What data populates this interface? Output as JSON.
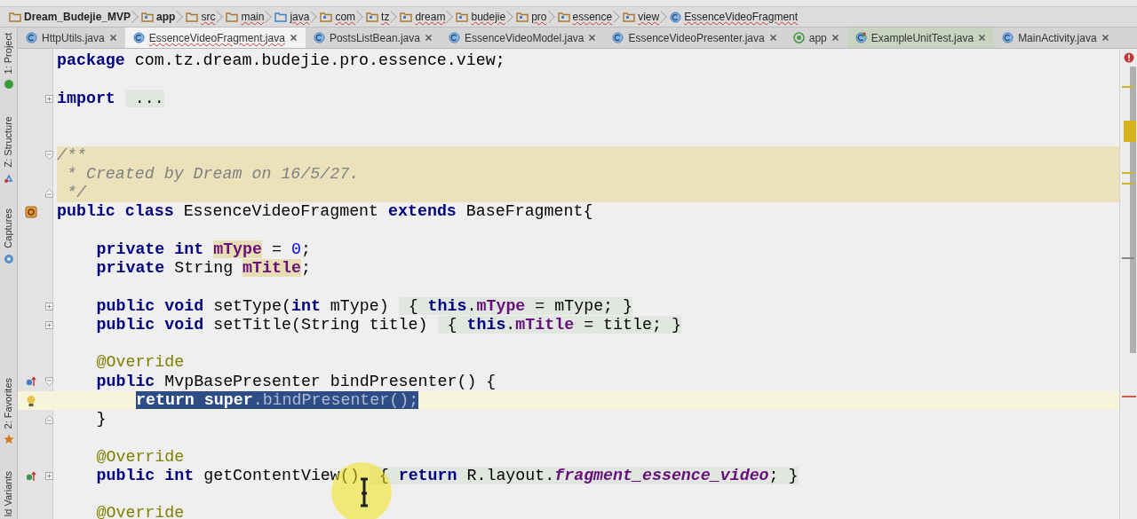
{
  "breadcrumbs": [
    {
      "label": "Dream_Budejie_MVP",
      "kind": "project",
      "spell_error": false
    },
    {
      "label": "app",
      "kind": "module",
      "spell_error": false
    },
    {
      "label": "src",
      "kind": "folder",
      "spell_error": true
    },
    {
      "label": "main",
      "kind": "folder",
      "spell_error": true
    },
    {
      "label": "java",
      "kind": "source",
      "spell_error": true
    },
    {
      "label": "com",
      "kind": "package",
      "spell_error": true
    },
    {
      "label": "tz",
      "kind": "package",
      "spell_error": true
    },
    {
      "label": "dream",
      "kind": "package",
      "spell_error": true
    },
    {
      "label": "budejie",
      "kind": "package",
      "spell_error": true
    },
    {
      "label": "pro",
      "kind": "package",
      "spell_error": true
    },
    {
      "label": "essence",
      "kind": "package",
      "spell_error": true
    },
    {
      "label": "view",
      "kind": "package",
      "spell_error": true
    },
    {
      "label": "EssenceVideoFragment",
      "kind": "class",
      "spell_error": true
    }
  ],
  "tool_windows": [
    {
      "label": "1: Project",
      "kind": "project"
    },
    {
      "label": "Z: Structure",
      "kind": "structure"
    },
    {
      "label": "Captures",
      "kind": "captures"
    },
    {
      "label": "2: Favorites",
      "kind": "favorites"
    },
    {
      "label": "ld Variants",
      "kind": "variants"
    }
  ],
  "tabs": [
    {
      "label": "HttpUtils.java",
      "kind": "class",
      "selected": false,
      "spell_error": false
    },
    {
      "label": "EssenceVideoFragment.java",
      "kind": "class",
      "selected": true,
      "spell_error": true
    },
    {
      "label": "PostsListBean.java",
      "kind": "class",
      "selected": false,
      "spell_error": false
    },
    {
      "label": "EssenceVideoModel.java",
      "kind": "class",
      "selected": false,
      "spell_error": false
    },
    {
      "label": "EssenceVideoPresenter.java",
      "kind": "class",
      "selected": false,
      "spell_error": false
    },
    {
      "label": "app",
      "kind": "module",
      "selected": false,
      "spell_error": false
    },
    {
      "label": "ExampleUnitTest.java",
      "kind": "test",
      "selected": false,
      "spell_error": false
    },
    {
      "label": "MainActivity.java",
      "kind": "class",
      "selected": false,
      "spell_error": false
    }
  ],
  "lines": [
    {
      "kind": "code",
      "tokens": [
        {
          "text": "package",
          "kind": "kw"
        },
        {
          "text": "com.tz.dream.budejie.pro.essence.view;",
          "kind": "plain",
          "gap": true
        }
      ]
    },
    {
      "kind": "blank"
    },
    {
      "kind": "code",
      "fold_marker": {
        "kind": "plus"
      },
      "tokens": [
        {
          "text": "import",
          "kind": "kw"
        }
      ],
      "folded": [
        {
          "text": "...",
          "kind": "plain",
          "gap": true
        }
      ]
    },
    {
      "kind": "blank"
    },
    {
      "kind": "blank"
    },
    {
      "kind": "code",
      "fold_marker": {
        "kind": "start"
      },
      "doc_comment": true,
      "tokens": [
        {
          "text": "/**",
          "kind": "comment"
        }
      ]
    },
    {
      "kind": "code",
      "doc_comment": true,
      "tokens": [
        {
          "text": "* Created by Dream on 16/5/27.",
          "kind": "comment",
          "gap": true
        }
      ]
    },
    {
      "kind": "code",
      "fold_marker": {
        "kind": "end"
      },
      "doc_comment": true,
      "tokens": [
        {
          "text": "*/",
          "kind": "comment",
          "gap": true
        }
      ]
    },
    {
      "kind": "code",
      "gutter_icon": {
        "kind": "class"
      },
      "tokens": [
        {
          "text": "public class",
          "kind": "kw"
        },
        {
          "text": "EssenceVideoFragment",
          "kind": "plain",
          "gap": true
        },
        {
          "text": "extends",
          "kind": "kw",
          "gap": true
        },
        {
          "text": "BaseFragment{",
          "kind": "plain",
          "gap": true
        }
      ],
      "children": [
        {
          "kind": "blank"
        },
        {
          "kind": "code",
          "tokens": [
            {
              "text": "private int",
              "kind": "kw"
            },
            {
              "text": "mType",
              "kind": "usage",
              "gap": true
            },
            {
              "text": "=",
              "kind": "plain",
              "gap": true
            },
            {
              "text": "0",
              "kind": "num",
              "gap": true
            },
            {
              "text": ";",
              "kind": "plain"
            }
          ]
        },
        {
          "kind": "code",
          "tokens": [
            {
              "text": "private",
              "kind": "kw"
            },
            {
              "text": "String",
              "kind": "plain",
              "gap": true
            },
            {
              "text": "mTitle",
              "kind": "usage",
              "gap": true
            },
            {
              "text": ";",
              "kind": "plain"
            }
          ]
        },
        {
          "kind": "blank"
        },
        {
          "kind": "code",
          "fold_marker": {
            "kind": "plus"
          },
          "tokens": [
            {
              "text": "public void",
              "kind": "kw"
            },
            {
              "text": "setType(",
              "kind": "plain",
              "gap": true
            },
            {
              "text": "int",
              "kind": "kw"
            },
            {
              "text": "mType)",
              "kind": "plain",
              "gap": true
            }
          ],
          "folded": [
            {
              "text": "{",
              "kind": "plain",
              "gap": true
            },
            {
              "text": "this",
              "kind": "kw",
              "gap": true
            },
            {
              "text": ".",
              "kind": "plain"
            },
            {
              "text": "mType",
              "kind": "field"
            },
            {
              "text": "= mType; }",
              "kind": "plain",
              "gap": true
            }
          ]
        },
        {
          "kind": "code",
          "fold_marker": {
            "kind": "plus"
          },
          "tokens": [
            {
              "text": "public void",
              "kind": "kw"
            },
            {
              "text": "setTitle(String title)",
              "kind": "plain",
              "gap": true
            }
          ],
          "folded": [
            {
              "text": "{",
              "kind": "plain",
              "gap": true
            },
            {
              "text": "this",
              "kind": "kw",
              "gap": true
            },
            {
              "text": ".",
              "kind": "plain"
            },
            {
              "text": "mTitle",
              "kind": "field"
            },
            {
              "text": "= title; }",
              "kind": "plain",
              "gap": true
            }
          ]
        },
        {
          "kind": "blank"
        },
        {
          "kind": "code",
          "tokens": [
            {
              "text": "@Override",
              "kind": "annot"
            }
          ]
        },
        {
          "kind": "code",
          "gutter_icon": {
            "kind": "overrides"
          },
          "fold_marker": {
            "kind": "start"
          },
          "tokens": [
            {
              "text": "public",
              "kind": "kw"
            },
            {
              "text": "MvpBasePresenter bindPresenter() {",
              "kind": "plain",
              "gap": true
            }
          ],
          "children": [
            {
              "kind": "code",
              "gutter_icon": {
                "kind": "bulb"
              },
              "current": true,
              "selection": [
                {
                  "text": "return",
                  "kind": "kw"
                },
                {
                  "text": "super",
                  "kind": "kw",
                  "gap": true
                },
                {
                  "text": ".bindPresenter();",
                  "kind": "plain"
                }
              ]
            }
          ]
        },
        {
          "kind": "code",
          "fold_marker": {
            "kind": "end"
          },
          "tokens": [
            {
              "text": "}",
              "kind": "plain"
            }
          ]
        },
        {
          "kind": "blank"
        },
        {
          "kind": "code",
          "tokens": [
            {
              "text": "@Override",
              "kind": "annot"
            }
          ]
        },
        {
          "kind": "code",
          "gutter_icon": {
            "kind": "implements"
          },
          "fold_marker": {
            "kind": "plus"
          },
          "tokens": [
            {
              "text": "public int",
              "kind": "kw"
            },
            {
              "text": "getContentView()",
              "kind": "plain",
              "gap": true
            }
          ],
          "folded": [
            {
              "text": "{",
              "kind": "plain",
              "gap": true
            },
            {
              "text": "return",
              "kind": "kw",
              "gap": true
            },
            {
              "text": "R.layout.",
              "kind": "plain",
              "gap": true
            },
            {
              "text": "fragment_essence_video",
              "kind": "const"
            },
            {
              "text": "; }",
              "kind": "plain"
            }
          ]
        },
        {
          "kind": "blank"
        },
        {
          "kind": "code",
          "tokens": [
            {
              "text": "@Override",
              "kind": "annot"
            }
          ]
        }
      ]
    }
  ]
}
